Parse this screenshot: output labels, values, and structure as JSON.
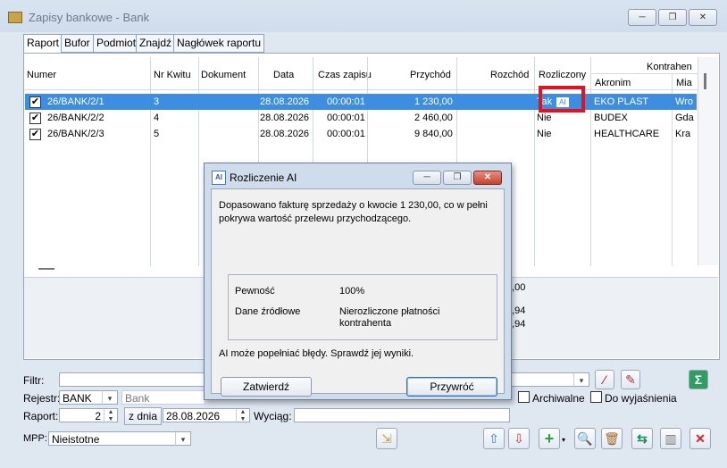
{
  "window": {
    "title": "Zapisy bankowe - Bank",
    "minimize": "─",
    "restore": "❐",
    "close": "✕"
  },
  "tabs": [
    "Raport",
    "Bufor",
    "Podmiot",
    "Znajdź",
    "Nagłówek raportu"
  ],
  "grid": {
    "columns": {
      "numer": "Numer",
      "nr_kwitu": "Nr Kwitu",
      "dokument": "Dokument",
      "data": "Data",
      "czas": "Czas zapisu",
      "przychod": "Przychód",
      "rozchod": "Rozchód",
      "rozliczony": "Rozliczony",
      "kontrahent": "Kontrahen",
      "akronim": "Akronim",
      "miasto": "Mia"
    },
    "rows": [
      {
        "checked": "✔",
        "numer": "26/BANK/2/1",
        "nr_kwitu": "3",
        "dokument": "",
        "data": "28.08.2026",
        "czas": "00:00:01",
        "przychod": "1 230,00",
        "rozchod": "",
        "rozliczony": "Tak",
        "badge": "AI",
        "akronim": "EKO PLAST",
        "miasto": "Wro"
      },
      {
        "checked": "✔",
        "numer": "26/BANK/2/2",
        "nr_kwitu": "4",
        "dokument": "",
        "data": "28.08.2026",
        "czas": "00:00:01",
        "przychod": "2 460,00",
        "rozchod": "",
        "rozliczony": "Nie",
        "badge": "",
        "akronim": "BUDEX",
        "miasto": "Gda"
      },
      {
        "checked": "✔",
        "numer": "26/BANK/2/3",
        "nr_kwitu": "5",
        "dokument": "",
        "data": "28.08.2026",
        "czas": "00:00:01",
        "przychod": "9 840,00",
        "rozchod": "",
        "rozliczony": "Nie",
        "badge": "",
        "akronim": "HEALTHCARE",
        "miasto": "Kra"
      }
    ],
    "summary": [
      "0,00",
      "7,94",
      "7,94"
    ]
  },
  "filters": {
    "filtr_label": "Filtr:",
    "rejestr_label": "Rejestr:",
    "rejestr_value": "BANK",
    "rejestr_name": "Bank",
    "raport_label": "Raport:",
    "raport_value": "2",
    "z_dnia_label": "z dnia",
    "z_dnia_value": "28.08.2026",
    "wyciag_label": "Wyciąg:",
    "archiwalne": "Archiwalne",
    "do_wyjasnienia": "Do wyjaśnienia",
    "mpp_label": "MPP:",
    "mpp_value": "Nieistotne"
  },
  "dialog": {
    "icon": "AI",
    "title": "Rozliczenie AI",
    "message": "Dopasowano fakturę sprzedaży o kwocie 1 230,00, co w pełni pokrywa wartość przelewu przychodzącego.",
    "pewnosc_label": "Pewność",
    "pewnosc_value": "100%",
    "zrodla_label": "Dane źródłowe",
    "zrodla_value": "Nierozliczone płatności kontrahenta",
    "warning": "AI może popełniać błędy. Sprawdź jej wyniki.",
    "confirm": "Zatwierdź",
    "revert": "Przywróć"
  },
  "colors": {
    "selection": "#3d8ee0",
    "highlight": "#e0141e"
  }
}
